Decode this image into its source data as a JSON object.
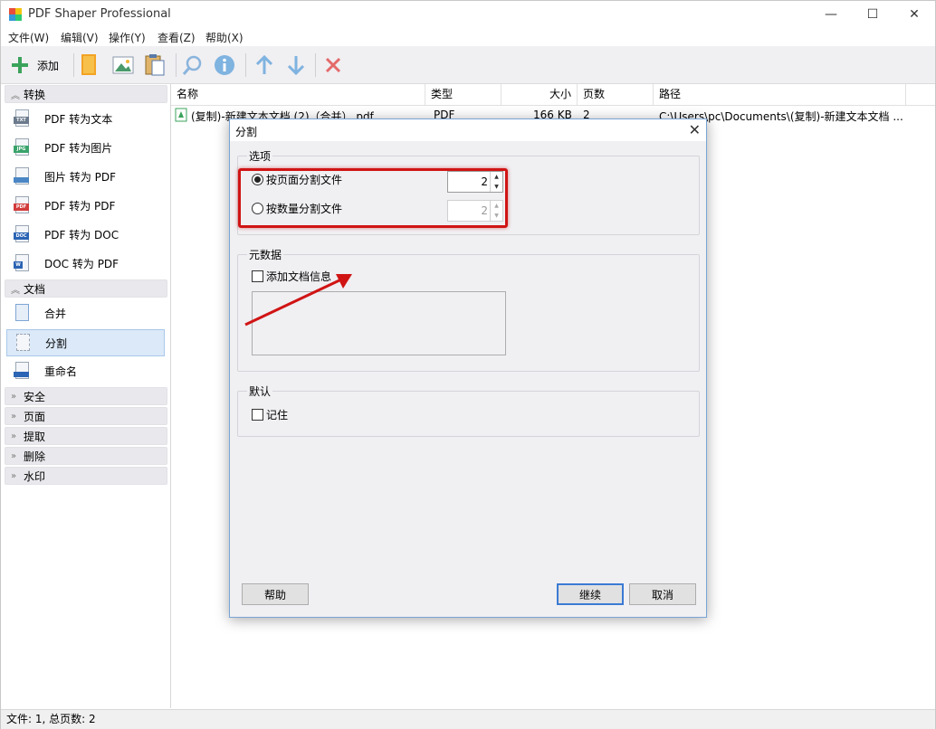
{
  "window": {
    "title": "PDF Shaper Professional",
    "minimize_icon": "minimize-icon",
    "maximize_icon": "maximize-icon",
    "close_icon": "close-icon"
  },
  "menu": [
    "文件(W)",
    "编辑(V)",
    "操作(Y)",
    "查看(Z)",
    "帮助(X)"
  ],
  "toolbar": {
    "add_label": "添加",
    "icons": [
      "plus-icon",
      "book-icon",
      "image-icon",
      "clipboard-icon",
      "search-icon",
      "info-icon",
      "arrow-up-icon",
      "arrow-down-icon",
      "delete-icon"
    ]
  },
  "sidebar": {
    "categories": {
      "convert": "转换",
      "document": "文档",
      "security": "安全",
      "page": "页面",
      "extract": "提取",
      "delete": "删除",
      "watermark": "水印"
    },
    "convert_items": [
      {
        "label": "PDF 转为文本",
        "tag": "TXT",
        "color": "#6b7a8c"
      },
      {
        "label": "PDF 转为图片",
        "tag": "JPG",
        "color": "#3aa36b"
      },
      {
        "label": "图片 转为 PDF",
        "tag": "",
        "color": "#4a86c5"
      },
      {
        "label": "PDF 转为 PDF",
        "tag": "PDF",
        "color": "#d23b3b"
      },
      {
        "label": "PDF 转为 DOC",
        "tag": "DOC",
        "color": "#2b64b4"
      },
      {
        "label": "DOC 转为 PDF",
        "tag": "W",
        "color": "#2b64b4"
      }
    ],
    "document_items": [
      {
        "label": "合并"
      },
      {
        "label": "分割"
      },
      {
        "label": "重命名"
      }
    ]
  },
  "file_list": {
    "columns": [
      "名称",
      "类型",
      "大小",
      "页数",
      "路径"
    ],
    "rows": [
      {
        "name": "(复制)-新建文本文档 (2)（合并）.pdf",
        "type": "PDF",
        "size": "166 KB",
        "pages": "2",
        "path": "C:\\Users\\pc\\Documents\\(复制)-新建文本文档 ..."
      }
    ]
  },
  "dialog": {
    "title": "分割",
    "options_group": "选项",
    "by_page_label": "按页面分割文件",
    "by_page_value": "2",
    "by_count_label": "按数量分割文件",
    "by_count_value": "2",
    "metadata_group": "元数据",
    "add_doc_info_label": "添加文档信息",
    "default_group": "默认",
    "remember_label": "记住",
    "help_button": "帮助",
    "continue_button": "继续",
    "cancel_button": "取消"
  },
  "status": "文件: 1, 总页数: 2",
  "colors": {
    "accent": "#3b7bd4",
    "highlight": "#d01414",
    "selected_bg": "#dbe9f8"
  }
}
